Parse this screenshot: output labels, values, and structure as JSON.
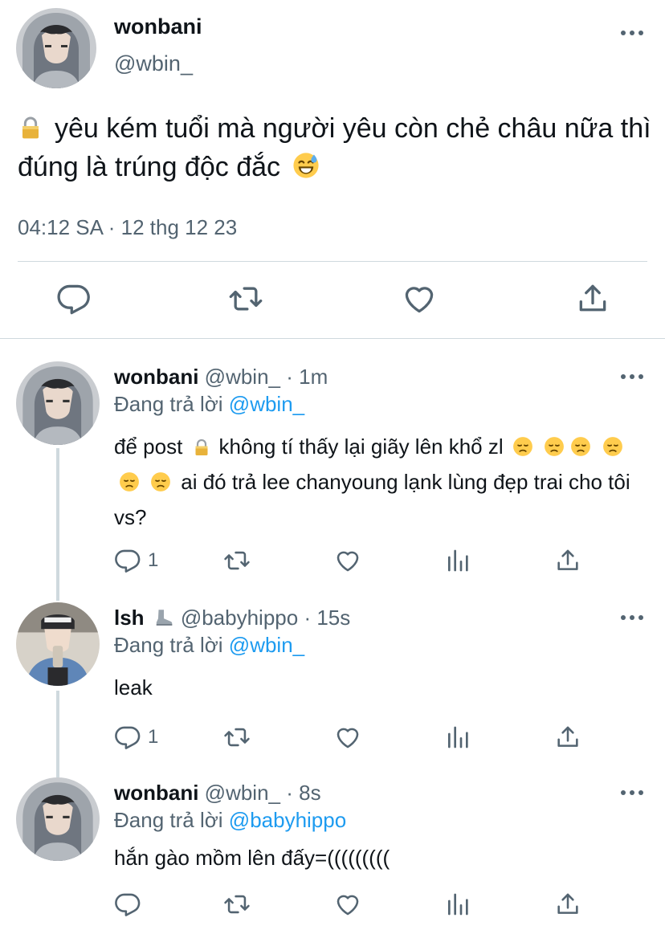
{
  "colors": {
    "accent": "#1d9bf0",
    "secondary_text": "#536471",
    "primary_text": "#0f1419",
    "divider": "#cfd9de"
  },
  "main_tweet": {
    "name": "wonbani",
    "handle": "@wbin_",
    "text": "yêu kém tuổi mà người yêu còn chẻ châu nữa thì đúng là trúng độc đắc",
    "leading_icon": "lock-emoji",
    "trailing_icon": "sweat-smile-emoji",
    "timestamp": "04:12 SA · 12 thg 12 23",
    "actions": [
      "reply-icon",
      "retweet-icon",
      "like-icon",
      "share-icon"
    ]
  },
  "replies": [
    {
      "name": "wonbani",
      "handle": "@wbin_",
      "time": "· 1m",
      "replying_to_prefix": "Đang trả lời",
      "replying_to": "@wbin_",
      "text_a": "để post",
      "text_b": "không tí thấy lại giãy lên khổ zl",
      "text_c": "ai đó trả lee chanyoung lạnk lùng đẹp trai cho tôi vs?",
      "reply_count": "1"
    },
    {
      "name": "lsh",
      "name_icon": "boot-emoji",
      "handle": "@babyhippo",
      "time": "· 15s",
      "replying_to_prefix": "Đang trả lời",
      "replying_to": "@wbin_",
      "text": "leak",
      "reply_count": "1"
    },
    {
      "name": "wonbani",
      "handle": "@wbin_",
      "time": "· 8s",
      "replying_to_prefix": "Đang trả lời",
      "replying_to": "@babyhippo",
      "text": "hắn gào mồm lên đấy=((((((((("
    }
  ]
}
